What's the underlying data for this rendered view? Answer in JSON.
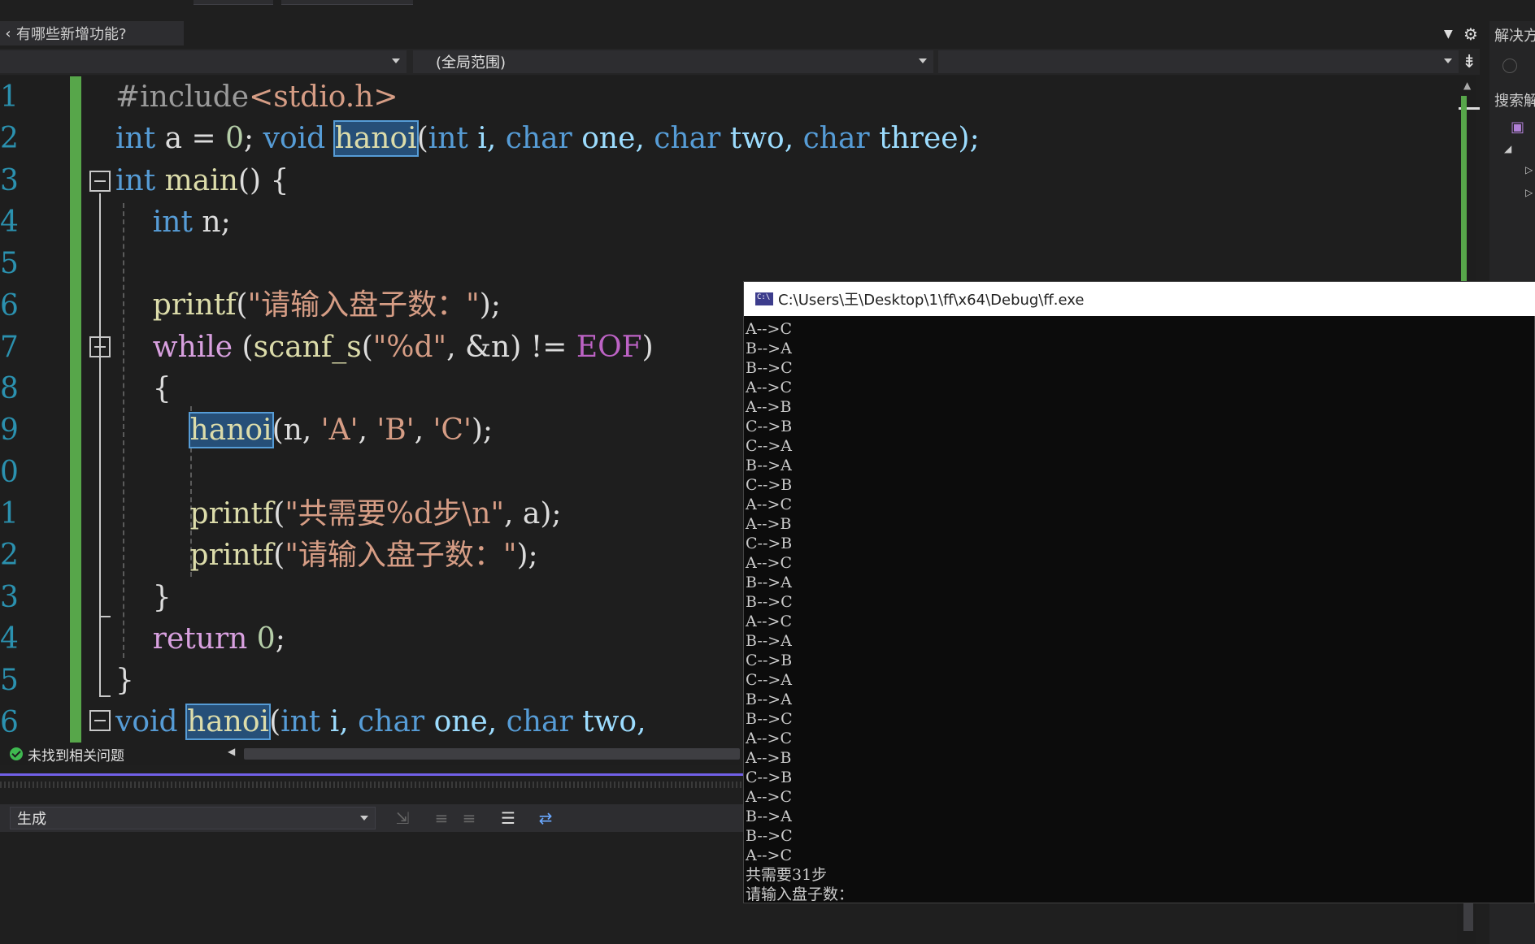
{
  "whats_new": {
    "label": "有哪些新增功能?"
  },
  "nav": {
    "scope_dropdown": "(全局范围)"
  },
  "right_panel": {
    "title": "解决方",
    "search": "搜索解"
  },
  "editor": {
    "line_numbers": [
      "1",
      "2",
      "3",
      "4",
      "5",
      "6",
      "7",
      "8",
      "9",
      "0",
      "1",
      "2",
      "3",
      "4",
      "5",
      "6"
    ],
    "lines": [
      [
        {
          "t": "#include",
          "c": "pp"
        },
        {
          "t": "<stdio.h>",
          "c": "st"
        }
      ],
      [
        {
          "t": "int",
          "c": "kw"
        },
        {
          "t": " a = ",
          "c": "id"
        },
        {
          "t": "0",
          "c": "num"
        },
        {
          "t": "; ",
          "c": "id"
        },
        {
          "t": "void",
          "c": "kw"
        },
        {
          "t": " ",
          "c": "id"
        },
        {
          "t": "hanoi",
          "c": "fn hl"
        },
        {
          "t": "(",
          "c": "id"
        },
        {
          "t": "int",
          "c": "kw"
        },
        {
          "t": " i, ",
          "c": "pr"
        },
        {
          "t": "char",
          "c": "kw"
        },
        {
          "t": " one, ",
          "c": "pr"
        },
        {
          "t": "char",
          "c": "kw"
        },
        {
          "t": " two, ",
          "c": "pr"
        },
        {
          "t": "char",
          "c": "kw"
        },
        {
          "t": " three);",
          "c": "pr"
        }
      ],
      [
        {
          "t": "int",
          "c": "kw"
        },
        {
          "t": " main",
          "c": "fn"
        },
        {
          "t": "() {",
          "c": "id"
        }
      ],
      [
        {
          "t": "    int",
          "c": "kw"
        },
        {
          "t": " n;",
          "c": "id"
        }
      ],
      [
        {
          "t": "",
          "c": "id"
        }
      ],
      [
        {
          "t": "    printf",
          "c": "fn"
        },
        {
          "t": "(",
          "c": "id"
        },
        {
          "t": "\"请输入盘子数：\"",
          "c": "st"
        },
        {
          "t": ");",
          "c": "id"
        }
      ],
      [
        {
          "t": "    while",
          "c": "kc"
        },
        {
          "t": " (",
          "c": "id"
        },
        {
          "t": "scanf_s",
          "c": "fn"
        },
        {
          "t": "(",
          "c": "id"
        },
        {
          "t": "\"%d\"",
          "c": "st"
        },
        {
          "t": ", &n) != ",
          "c": "id"
        },
        {
          "t": "EOF",
          "c": "mac"
        },
        {
          "t": ")",
          "c": "id"
        }
      ],
      [
        {
          "t": "    {",
          "c": "id"
        }
      ],
      [
        {
          "t": "        ",
          "c": "id"
        },
        {
          "t": "hanoi",
          "c": "fn hl"
        },
        {
          "t": "(n, ",
          "c": "id"
        },
        {
          "t": "'A'",
          "c": "st"
        },
        {
          "t": ", ",
          "c": "id"
        },
        {
          "t": "'B'",
          "c": "st"
        },
        {
          "t": ", ",
          "c": "id"
        },
        {
          "t": "'C'",
          "c": "st"
        },
        {
          "t": ");",
          "c": "id"
        }
      ],
      [
        {
          "t": "",
          "c": "id"
        }
      ],
      [
        {
          "t": "        printf",
          "c": "fn"
        },
        {
          "t": "(",
          "c": "id"
        },
        {
          "t": "\"共需要%d步\\n\"",
          "c": "st"
        },
        {
          "t": ", a);",
          "c": "id"
        }
      ],
      [
        {
          "t": "        printf",
          "c": "fn"
        },
        {
          "t": "(",
          "c": "id"
        },
        {
          "t": "\"请输入盘子数：\"",
          "c": "st"
        },
        {
          "t": ");",
          "c": "id"
        }
      ],
      [
        {
          "t": "    }",
          "c": "id"
        }
      ],
      [
        {
          "t": "    return",
          "c": "kc"
        },
        {
          "t": " ",
          "c": "id"
        },
        {
          "t": "0",
          "c": "num"
        },
        {
          "t": ";",
          "c": "id"
        }
      ],
      [
        {
          "t": "}",
          "c": "id"
        }
      ],
      [
        {
          "t": "void",
          "c": "kw"
        },
        {
          "t": " ",
          "c": "id"
        },
        {
          "t": "hanoi",
          "c": "fn hl"
        },
        {
          "t": "(",
          "c": "id"
        },
        {
          "t": "int",
          "c": "kw"
        },
        {
          "t": " i, ",
          "c": "pr"
        },
        {
          "t": "char",
          "c": "kw"
        },
        {
          "t": " one, ",
          "c": "pr"
        },
        {
          "t": "char",
          "c": "kw"
        },
        {
          "t": " two,",
          "c": "pr"
        }
      ]
    ]
  },
  "status": {
    "text": "未找到相关问题"
  },
  "output": {
    "source": "生成"
  },
  "console": {
    "title": "C:\\Users\\王\\Desktop\\1\\ff\\x64\\Debug\\ff.exe",
    "lines": [
      "A-->C",
      "B-->A",
      "B-->C",
      "A-->C",
      "A-->B",
      "C-->B",
      "C-->A",
      "B-->A",
      "C-->B",
      "A-->C",
      "A-->B",
      "C-->B",
      "A-->C",
      "B-->A",
      "B-->C",
      "A-->C",
      "B-->A",
      "C-->B",
      "C-->A",
      "B-->A",
      "B-->C",
      "A-->C",
      "A-->B",
      "C-->B",
      "A-->C",
      "B-->A",
      "B-->C",
      "A-->C",
      "共需要31步",
      "请输入盘子数："
    ]
  }
}
